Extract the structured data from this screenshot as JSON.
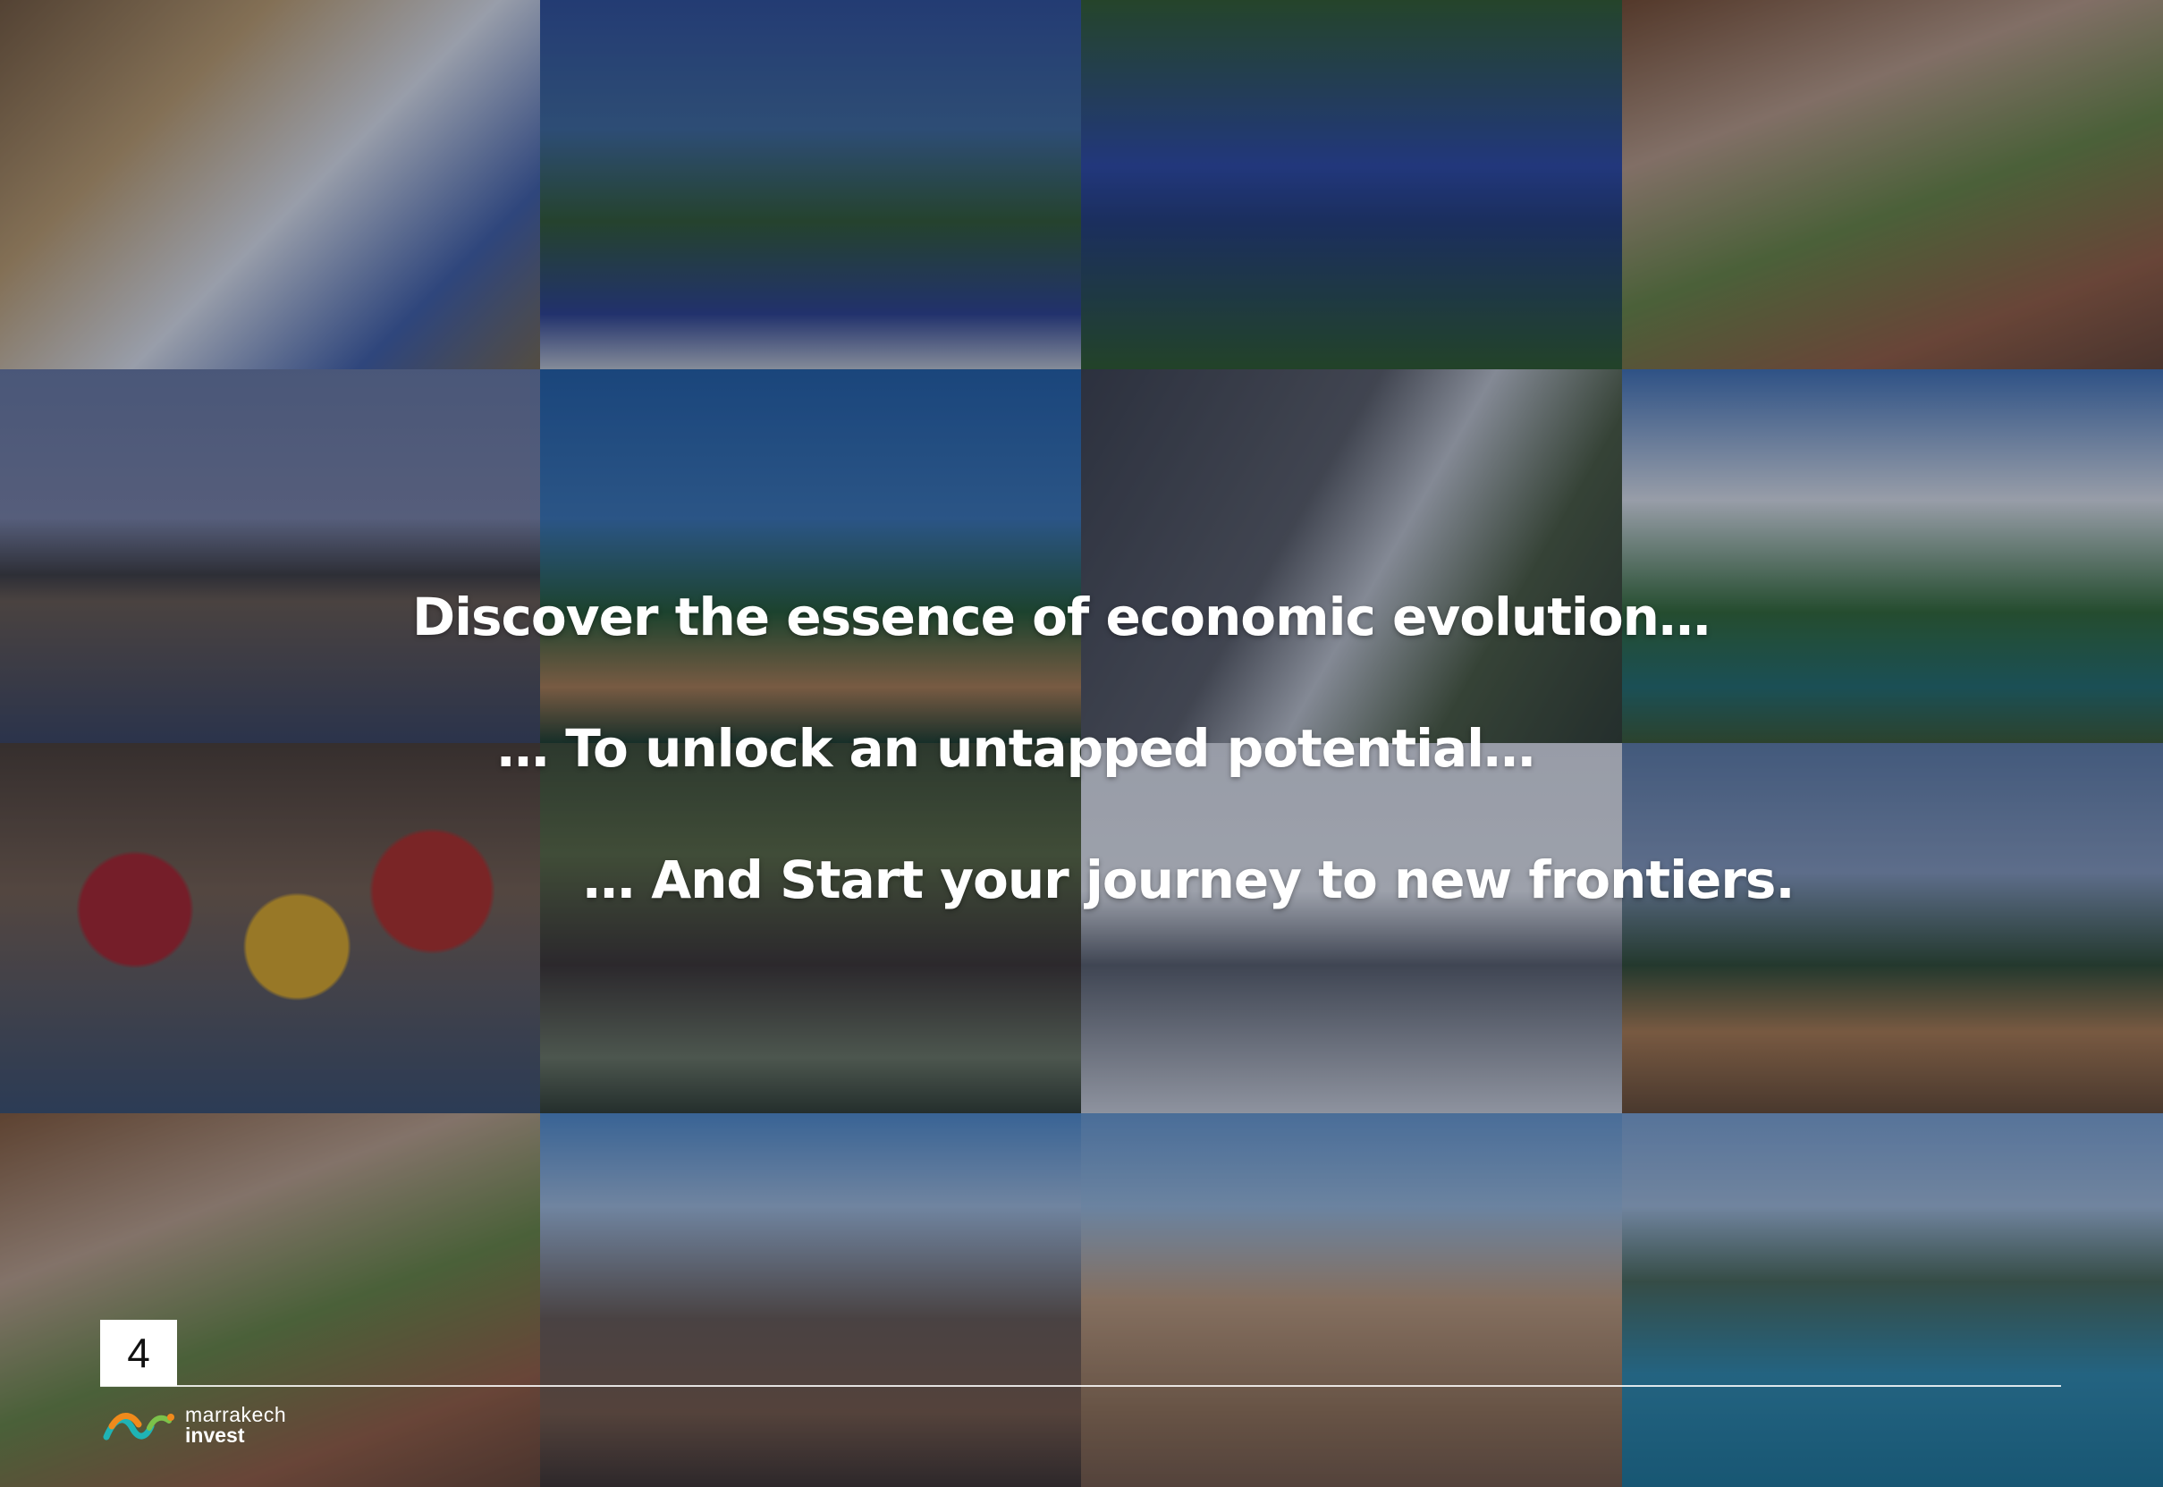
{
  "headlines": [
    "Discover the essence of economic evolution…",
    "… To unlock an untapped potential…",
    "… And Start your journey to new frontiers."
  ],
  "page_number": "4",
  "logo": {
    "line1": "marrakech",
    "line2": "invest",
    "colors": {
      "orange": "#f08a1c",
      "teal": "#1fb3b5",
      "green": "#7cc24a"
    }
  },
  "photo_tiles": [
    "bahia-palace-gallery-photo",
    "majorelle-garden-photo",
    "garden-pool-reflection-photo",
    "kasbah-cave-view-photo",
    "menara-pavilion-photo",
    "koutoubia-minaret-photo",
    "waterfall-photo",
    "palace-garden-photo",
    "spice-cones-photo",
    "riad-garden-gazebo-photo",
    "palace-courtyard-photo",
    "city-walls-palms-photo",
    "kasbah-cave-view-photo-2",
    "hiker-mountains-photo",
    "hot-air-balloons-photo",
    "mountain-lake-photo"
  ]
}
